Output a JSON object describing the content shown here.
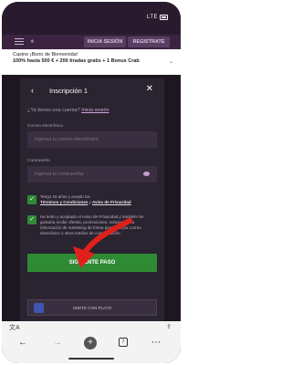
{
  "status_bar": {
    "network": "LTE"
  },
  "header": {
    "login_label": "INICIA SESIÓN",
    "register_label": "REGISTRATE"
  },
  "promo": {
    "line1": "Casino ¡Bono de Bienvenida!",
    "line2": "100% hasta 500 € + 200 tiradas gratis + 1 Bonus Crab"
  },
  "modal": {
    "title": "Inscripción 1",
    "account_question": "¿Ya tienes una cuenta?",
    "login_link": "Inicia sesión",
    "email_label": "Correo electrónico",
    "email_placeholder": "Ingresa tu correo electrónico",
    "password_label": "Contraseña",
    "password_placeholder": "Ingresa tu contraseña",
    "terms_text": "Tengo 18 años y acepto los",
    "terms_link": "Términos y Condiciones",
    "terms_and": "y",
    "privacy_link": "Aviso de Privacidad",
    "marketing_text": "He leído y aceptado el Aviso de Privacidad y también me gustaría recibir ofertas, promociones, noticias y otra información de marketing de forma periódica por correo electrónico u otros medios de comunicación.",
    "next_label": "SIGUIENTE PASO",
    "alt_label": "ÚNETE CON PLAYO"
  },
  "browser": {
    "tabs_count": "7"
  },
  "colors": {
    "accent_green": "#2f8a34",
    "arrow_red": "#e0201b",
    "modal_bg": "#2a2330"
  }
}
